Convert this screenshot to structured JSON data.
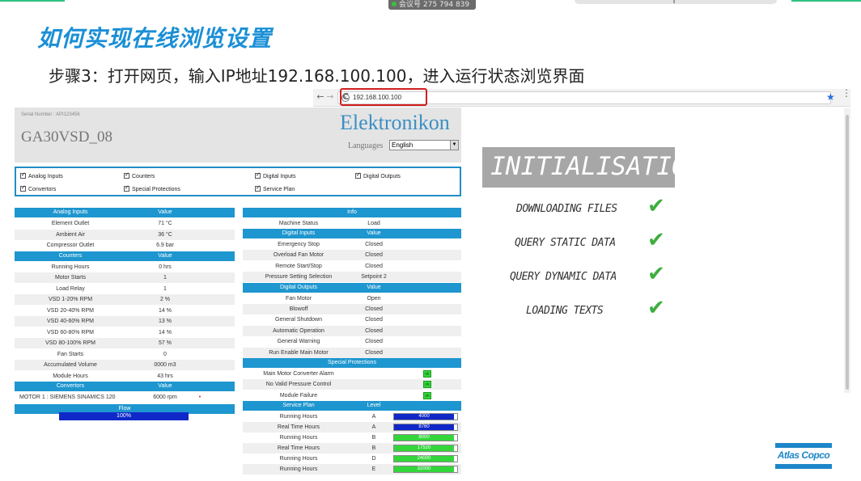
{
  "slide": {
    "title": "如何实现在线浏览设置",
    "step": "步骤3：打开网页，输入IP地址192.168.100.100，进入运行状态浏览界面"
  },
  "meeting": {
    "label": "会议号 275 794 839"
  },
  "browser": {
    "back": "←",
    "forward": "→",
    "reload": "C",
    "info_icon": "i",
    "url": "192.168.100.100",
    "star": "★"
  },
  "header": {
    "serial": "Serial Number : API123456",
    "device": "GA30VSD_08",
    "brand": "Elektronikon",
    "languages_label": "Languages",
    "language_value": "English"
  },
  "checkboxes": [
    "Analog Inputs",
    "Counters",
    "Digital Inputs",
    "Digital Outputs",
    "Convertors",
    "Special Protections",
    "Service Plan"
  ],
  "left_table": {
    "analog": {
      "header": [
        "Analog Inputs",
        "Value"
      ],
      "rows": [
        [
          "Element Outlet",
          "71 °C"
        ],
        [
          "Ambient Air",
          "36 °C"
        ],
        [
          "Compressor Outlet",
          "6.9 bar"
        ]
      ]
    },
    "counters": {
      "header": [
        "Counters",
        "Value"
      ],
      "rows": [
        [
          "Running Hours",
          "0 hrs"
        ],
        [
          "Motor Starts",
          "1"
        ],
        [
          "Load Relay",
          "1"
        ],
        [
          "VSD 1-20% RPM",
          "2 %"
        ],
        [
          "VSD 20-40% RPM",
          "14 %"
        ],
        [
          "VSD 40-60% RPM",
          "13 %"
        ],
        [
          "VSD 60-80% RPM",
          "14 %"
        ],
        [
          "VSD 80-100% RPM",
          "57 %"
        ],
        [
          "Fan Starts",
          "0"
        ],
        [
          "Accumulated Volume",
          "0000 m3"
        ],
        [
          "Module Hours",
          "43 hrs"
        ]
      ]
    },
    "convertors": {
      "header": [
        "Convertors",
        "Value"
      ],
      "rows": [
        [
          "MOTOR 1 : SIEMENS SINAMICS 120",
          "6000 rpm"
        ]
      ]
    },
    "flow": {
      "header": "Flow",
      "value": "100%"
    }
  },
  "right_table": {
    "info": {
      "header": "Info",
      "rows": [
        [
          "Machine Status",
          "Load"
        ]
      ]
    },
    "digital_inputs": {
      "header": [
        "Digital Inputs",
        "Value"
      ],
      "rows": [
        [
          "Emergency Stop",
          "Closed"
        ],
        [
          "Overload Fan Motor",
          "Closed"
        ],
        [
          "Remote Start/Stop",
          "Closed"
        ],
        [
          "Pressure Setting Selection",
          "Setpoint 2"
        ]
      ]
    },
    "digital_outputs": {
      "header": [
        "Digital Outputs",
        "Value"
      ],
      "rows": [
        [
          "Fan Motor",
          "Open"
        ],
        [
          "Blowoff",
          "Closed"
        ],
        [
          "General Shutdown",
          "Closed"
        ],
        [
          "Automatic Operation",
          "Closed"
        ],
        [
          "General Warning",
          "Closed"
        ],
        [
          "Run Enable Main Motor",
          "Closed"
        ]
      ]
    },
    "special_protections": {
      "header": "Special Protections",
      "rows": [
        "Main Motor Converter Alarm",
        "No Valid Pressure Control",
        "Module Failure"
      ],
      "led_label": "ok"
    },
    "service_plan": {
      "header": [
        "Service Plan",
        "Level"
      ],
      "rows": [
        {
          "name": "Running Hours",
          "level": "A",
          "value": "4000",
          "fill": 0.95,
          "color": "#1028c8"
        },
        {
          "name": "Real Time Hours",
          "level": "A",
          "value": "8760",
          "fill": 0.95,
          "color": "#1028c8"
        },
        {
          "name": "Running Hours",
          "level": "B",
          "value": "8000",
          "fill": 0.95,
          "color": "#33d63a"
        },
        {
          "name": "Real Time Hours",
          "level": "B",
          "value": "17520",
          "fill": 0.95,
          "color": "#33d63a"
        },
        {
          "name": "Running Hours",
          "level": "D",
          "value": "24000",
          "fill": 0.95,
          "color": "#33d63a"
        },
        {
          "name": "Running Hours",
          "level": "E",
          "value": "32000",
          "fill": 0.95,
          "color": "#33d63a"
        }
      ]
    }
  },
  "initialisation": {
    "title": "INITIALISATION",
    "items": [
      "DOWNLOADING FILES",
      "QUERY STATIC DATA",
      "QUERY DYNAMIC DATA",
      "LOADING TEXTS"
    ],
    "check": "✔"
  },
  "logo": {
    "text": "Atlas Copco"
  }
}
